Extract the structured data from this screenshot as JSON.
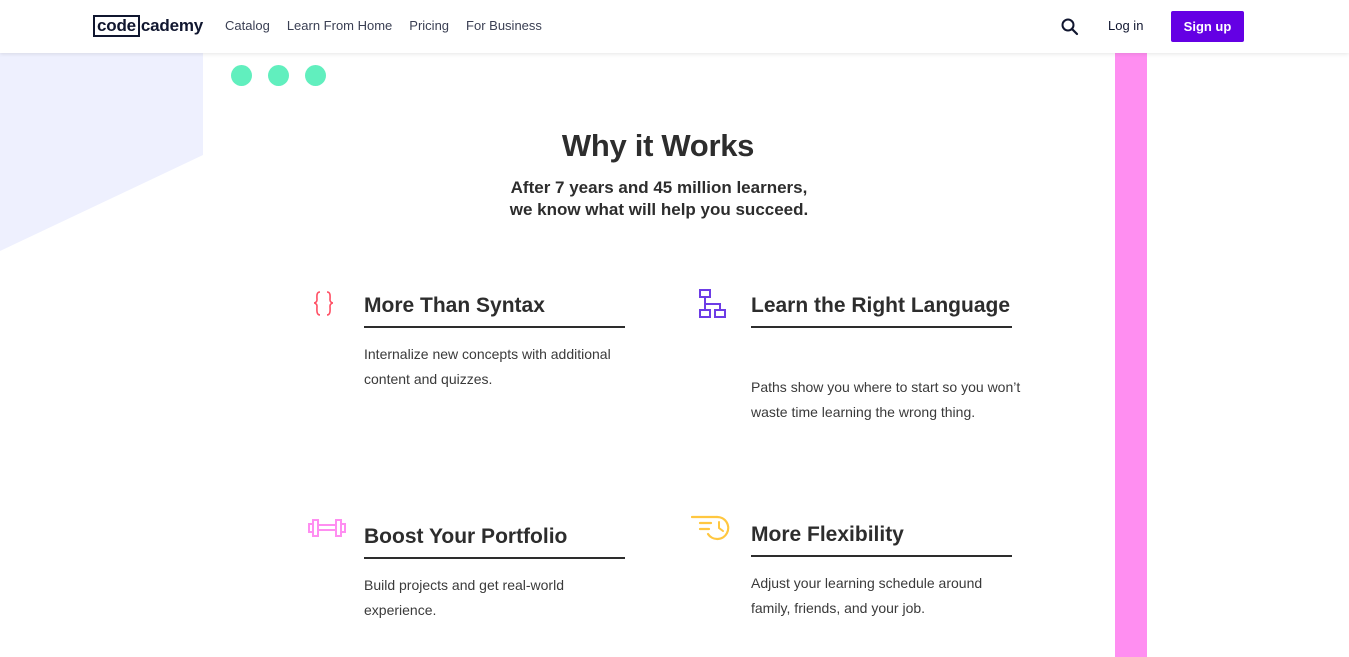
{
  "header": {
    "logo": {
      "boxed": "code",
      "rest": "cademy"
    },
    "nav": [
      "Catalog",
      "Learn From Home",
      "Pricing",
      "For Business"
    ],
    "search_icon": "search-icon",
    "login_label": "Log in",
    "signup_label": "Sign up"
  },
  "colors": {
    "brand_purple": "#6400e4",
    "mint": "#61efbe",
    "pink": "#ff8ef1",
    "lavender": "#eef0fe",
    "text": "#2d2d2d"
  },
  "section": {
    "title": "Why it Works",
    "subtitle_line1": "After 7 years and 45 million learners,",
    "subtitle_line2": "we know what will help you succeed."
  },
  "features": [
    {
      "icon": "curly-braces-icon",
      "title": "More Than Syntax",
      "desc": "Internalize new concepts with additional content and quizzes."
    },
    {
      "icon": "flowchart-icon",
      "title": "Learn the Right Language",
      "desc": "Paths show you where to start so you won’t waste time learning the wrong thing."
    },
    {
      "icon": "dumbbell-icon",
      "title": "Boost Your Portfolio",
      "desc": "Build projects and get real-world experience."
    },
    {
      "icon": "fast-clock-icon",
      "title": "More Flexibility",
      "desc": "Adjust your learning schedule around family, friends, and your job."
    }
  ]
}
